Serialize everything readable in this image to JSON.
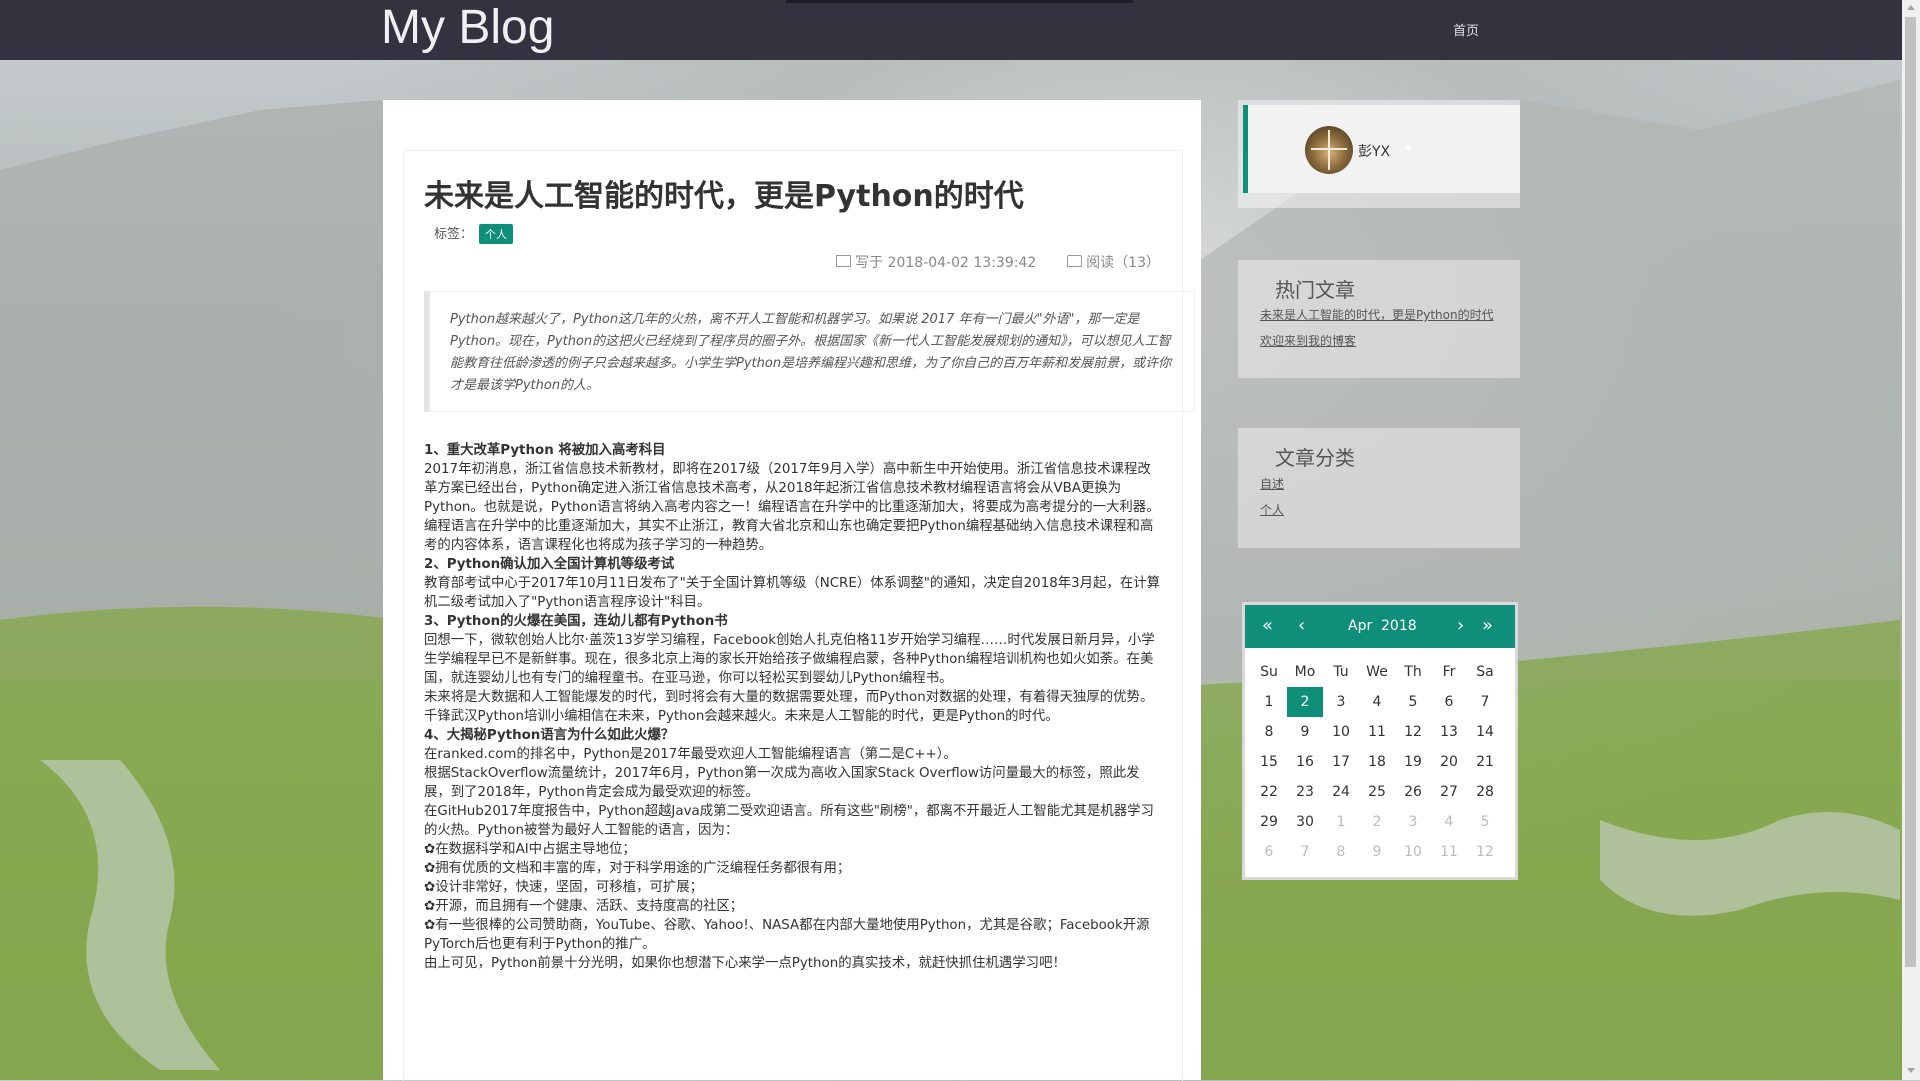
{
  "nav": {
    "brand": "My Blog",
    "home": "首页"
  },
  "article": {
    "title": "未来是人工智能的时代，更是Python的时代",
    "tag_label": "标签：",
    "tag": "个人",
    "written": "写于 2018-04-02 13:39:42",
    "reads": "阅读（13）",
    "abstract": "Python越来越火了，Python这几年的火热，离不开人工智能和机器学习。如果说 2017 年有一门最火\"外语\"，那一定是Python。现在，Python的这把火已经烧到了程序员的圈子外。根据国家《新一代人工智能发展规划的通知》，可以想见人工智能教育往低龄渗透的例子只会越来越多。小学生学Python是培养编程兴趣和思维，为了你自己的百万年薪和发展前景，或许你才是最该学Python的人。",
    "paragraphs": [
      {
        "bold": true,
        "text": "1、重大改革Python 将被加入高考科目"
      },
      {
        "bold": false,
        "text": "2017年初消息，浙江省信息技术新教材，即将在2017级（2017年9月入学）高中新生中开始使用。浙江省信息技术课程改革方案已经出台，Python确定进入浙江省信息技术高考，从2018年起浙江省信息技术教材编程语言将会从VBA更换为Python。也就是说，Python语言将纳入高考内容之一！编程语言在升学中的比重逐渐加大，将要成为高考提分的一大利器。"
      },
      {
        "bold": false,
        "text": "编程语言在升学中的比重逐渐加大，其实不止浙江，教育大省北京和山东也确定要把Python编程基础纳入信息技术课程和高考的内容体系，语言课程化也将成为孩子学习的一种趋势。"
      },
      {
        "bold": true,
        "text": "2、Python确认加入全国计算机等级考试"
      },
      {
        "bold": false,
        "text": "教育部考试中心于2017年10月11日发布了\"关于全国计算机等级（NCRE）体系调整\"的通知，决定自2018年3月起，在计算机二级考试加入了\"Python语言程序设计\"科目。"
      },
      {
        "bold": true,
        "text": "3、Python的火爆在美国，连幼儿都有Python书"
      },
      {
        "bold": false,
        "text": "回想一下，微软创始人比尔·盖茨13岁学习编程，Facebook创始人扎克伯格11岁开始学习编程……时代发展日新月异，小学生学编程早已不是新鲜事。现在，很多北京上海的家长开始给孩子做编程启蒙，各种Python编程培训机构也如火如荼。在美国，就连婴幼儿也有专门的编程童书。在亚马逊，你可以轻松买到婴幼儿Python编程书。"
      },
      {
        "bold": false,
        "text": "未来将是大数据和人工智能爆发的时代，到时将会有大量的数据需要处理，而Python对数据的处理，有着得天独厚的优势。千锋武汉Python培训小编相信在未来，Python会越来越火。未来是人工智能的时代，更是Python的时代。"
      },
      {
        "bold": true,
        "text": "4、大揭秘Python语言为什么如此火爆？"
      },
      {
        "bold": false,
        "text": "在ranked.com的排名中，Python是2017年最受欢迎人工智能编程语言（第二是C++）。"
      },
      {
        "bold": false,
        "text": "根据StackOverflow流量统计，2017年6月，Python第一次成为高收入国家Stack Overflow访问量最大的标签，照此发展，到了2018年，Python肯定会成为最受欢迎的标签。"
      },
      {
        "bold": false,
        "text": "在GitHub2017年度报告中，Python超越Java成第二受欢迎语言。所有这些\"刷榜\"，都离不开最近人工智能尤其是机器学习的火热。Python被誉为最好人工智能的语言，因为："
      },
      {
        "bold": false,
        "text": "✿在数据科学和AI中占据主导地位；"
      },
      {
        "bold": false,
        "text": "✿拥有优质的文档和丰富的库，对于科学用途的广泛编程任务都很有用；"
      },
      {
        "bold": false,
        "text": "✿设计非常好，快速，坚固，可移植，可扩展；"
      },
      {
        "bold": false,
        "text": "✿开源，而且拥有一个健康、活跃、支持度高的社区；"
      },
      {
        "bold": false,
        "text": "✿有一些很棒的公司赞助商，YouTube、谷歌、Yahoo!、NASA都在内部大量地使用Python，尤其是谷歌；Facebook开源PyTorch后也更有利于Python的推广。"
      },
      {
        "bold": false,
        "text": "由上可见，Python前景十分光明，如果你也想潜下心来学一点Python的真实技术，就赶快抓住机遇学习吧！"
      }
    ]
  },
  "profile": {
    "name": "彭YX"
  },
  "hot": {
    "title": "热门文章",
    "items": [
      "未来是人工智能的时代，更是Python的时代",
      "欢迎来到我的博客"
    ]
  },
  "categories": {
    "title": "文章分类",
    "items": [
      "自述",
      "个人"
    ]
  },
  "calendar": {
    "month": "Apr",
    "year": "2018",
    "selected": "2",
    "dow": [
      "Su",
      "Mo",
      "Tu",
      "We",
      "Th",
      "Fr",
      "Sa"
    ],
    "weeks": [
      [
        "1",
        "2",
        "3",
        "4",
        "5",
        "6",
        "7"
      ],
      [
        "8",
        "9",
        "10",
        "11",
        "12",
        "13",
        "14"
      ],
      [
        "15",
        "16",
        "17",
        "18",
        "19",
        "20",
        "21"
      ],
      [
        "22",
        "23",
        "24",
        "25",
        "26",
        "27",
        "28"
      ],
      [
        "29",
        "30",
        "1",
        "2",
        "3",
        "4",
        "5"
      ],
      [
        "6",
        "7",
        "8",
        "9",
        "10",
        "11",
        "12"
      ]
    ],
    "first_other_index": 30
  },
  "colors": {
    "accent": "#0f8e7a",
    "navbar": "#32333f"
  },
  "icons": [
    "calendar-icon",
    "book-icon",
    "double-chevron-left-icon",
    "chevron-left-icon",
    "chevron-right-icon",
    "double-chevron-right-icon"
  ]
}
